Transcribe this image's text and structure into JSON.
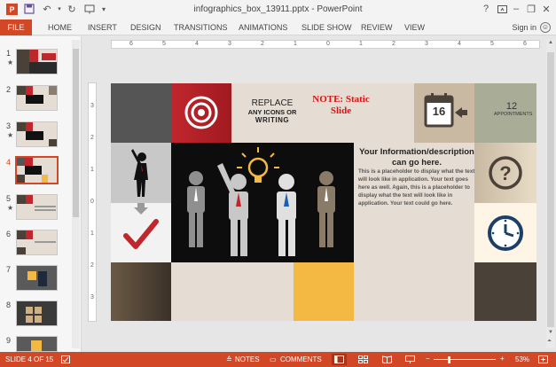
{
  "title_bar": {
    "document_title": "infographics_box_13911.pptx - PowerPoint",
    "help_label": "?",
    "minimize_label": "–",
    "restore_label": "❐",
    "close_label": "✕"
  },
  "ribbon": {
    "file_label": "FILE",
    "tabs": [
      "HOME",
      "INSERT",
      "DESIGN",
      "TRANSITIONS",
      "ANIMATIONS",
      "SLIDE SHOW",
      "REVIEW",
      "VIEW"
    ],
    "sign_in_label": "Sign in"
  },
  "thumbnails": {
    "slides": [
      {
        "number": "1",
        "star": true
      },
      {
        "number": "2",
        "star": false
      },
      {
        "number": "3",
        "star": true
      },
      {
        "number": "4",
        "star": false,
        "selected": true
      },
      {
        "number": "5",
        "star": true
      },
      {
        "number": "6",
        "star": false
      },
      {
        "number": "7",
        "star": false
      },
      {
        "number": "8",
        "star": false
      },
      {
        "number": "9",
        "star": false
      }
    ]
  },
  "ruler": {
    "horizontal_ticks": [
      "6",
      "5",
      "4",
      "3",
      "2",
      "1",
      "0",
      "1",
      "2",
      "3",
      "4",
      "5",
      "6"
    ],
    "vertical_ticks": [
      "3",
      "2",
      "1",
      "0",
      "1",
      "2",
      "3"
    ]
  },
  "slide": {
    "replace_line1": "REPLACE",
    "replace_line2": "ANY ICONS OR",
    "replace_line3": "WRITING",
    "note_line1": "NOTE: Static",
    "note_line2": "Slide",
    "calendar_day": "16",
    "appointments_count": "12",
    "appointments_label": "APPOINTMENTS",
    "info_title": "Your Information/description can go here.",
    "info_body": "This is a placeholder to display what the text will look like in application. Your text goes here as well. Again, this is a placeholder to display what the text will look like in application. Your text could go here."
  },
  "status_bar": {
    "slide_indicator": "SLIDE 4 OF 15",
    "notes_label": "NOTES",
    "comments_label": "COMMENTS",
    "zoom_label": "53%",
    "zoom_percent": 53
  },
  "colors": {
    "accent": "#d24726",
    "slide_red": "#c0272d",
    "slide_beige": "#e5ddd3",
    "slide_dark": "#4a4139",
    "slide_gold": "#f4b942",
    "slide_navy": "#1b3f66"
  }
}
